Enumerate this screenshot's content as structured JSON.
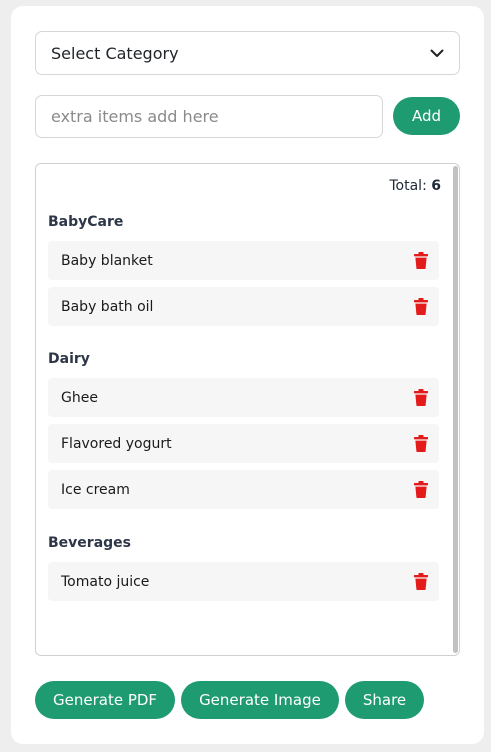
{
  "category_select": {
    "value": "Select Category",
    "icon": "chevron-down-icon"
  },
  "extra_items": {
    "placeholder": "extra items add here",
    "add_label": "Add"
  },
  "list": {
    "total_label": "Total:",
    "total_value": "6",
    "categories": [
      {
        "name": "BabyCare",
        "items": [
          "Baby blanket",
          "Baby bath oil"
        ]
      },
      {
        "name": "Dairy",
        "items": [
          "Ghee",
          "Flavored yogurt",
          "Ice cream"
        ]
      },
      {
        "name": "Beverages",
        "items": [
          "Tomato juice"
        ]
      }
    ]
  },
  "actions": {
    "pdf_label": "Generate PDF",
    "image_label": "Generate Image",
    "share_label": "Share"
  },
  "colors": {
    "accent": "#1f9b71",
    "delete": "#e41b1b",
    "row_bg": "#f6f6f6"
  }
}
